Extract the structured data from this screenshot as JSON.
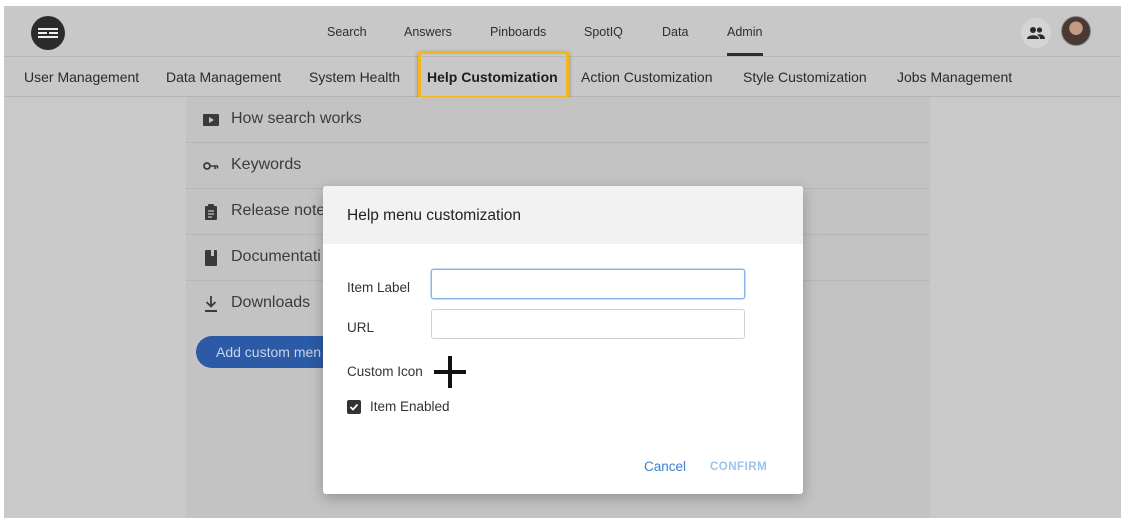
{
  "top_nav": {
    "items": [
      "Search",
      "Answers",
      "Pinboards",
      "SpotIQ",
      "Data",
      "Admin"
    ],
    "active": "Admin"
  },
  "sub_nav": {
    "items": [
      "User Management",
      "Data Management",
      "System Health",
      "Help Customization",
      "Action Customization",
      "Style Customization",
      "Jobs Management"
    ],
    "active": "Help Customization"
  },
  "help_items": [
    {
      "label": "How search works",
      "icon": "play-icon"
    },
    {
      "label": "Keywords",
      "icon": "key-icon"
    },
    {
      "label": "Release note",
      "icon": "clipboard-icon"
    },
    {
      "label": "Documentati",
      "icon": "book-icon"
    },
    {
      "label": "Downloads",
      "icon": "download-icon"
    }
  ],
  "add_button_label": "Add custom men",
  "modal": {
    "title": "Help menu customization",
    "item_label": {
      "label": "Item Label",
      "value": "",
      "placeholder": ""
    },
    "url": {
      "label": "URL",
      "value": "",
      "placeholder": ""
    },
    "custom_icon_label": "Custom Icon",
    "item_enabled_label": "Item Enabled",
    "item_enabled": true,
    "cancel_label": "Cancel",
    "confirm_label": "CONFIRM"
  },
  "colors": {
    "highlight": "#f3b61f",
    "primary_button": "#2c5aa6",
    "link": "#3b80d2",
    "confirm_disabled": "#9cc3ee"
  }
}
